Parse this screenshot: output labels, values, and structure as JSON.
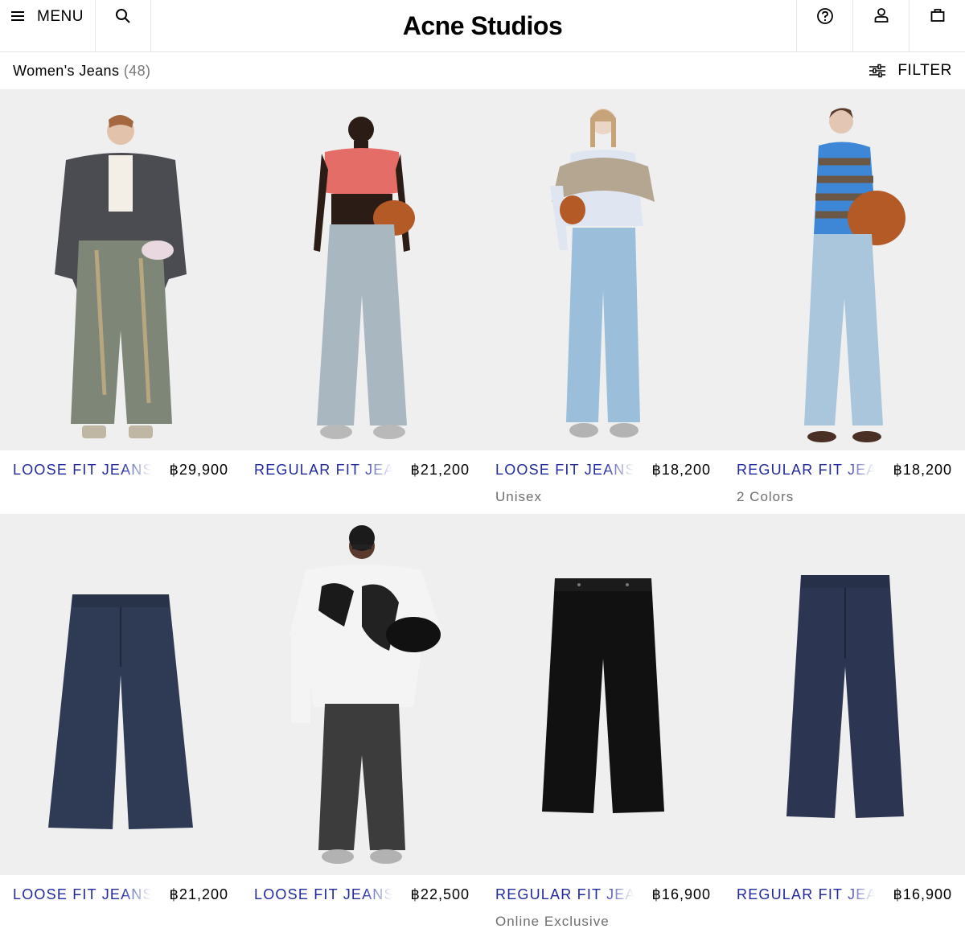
{
  "header": {
    "menu_label": "MENU",
    "logo": "Acne Studios",
    "icons": [
      "menu-icon",
      "search-icon",
      "help-icon",
      "account-icon",
      "bag-icon"
    ]
  },
  "listing": {
    "title": "Women's Jeans",
    "count": "(48)",
    "filter_label": "FILTER"
  },
  "products": [
    {
      "name": "LOOSE FIT JEANS",
      "price": "฿29,900",
      "sub": ""
    },
    {
      "name": "REGULAR FIT JEANS",
      "price": "฿21,200",
      "sub": ""
    },
    {
      "name": "LOOSE FIT JEANS",
      "price": "฿18,200",
      "sub": "Unisex"
    },
    {
      "name": "REGULAR FIT JEANS",
      "price": "฿18,200",
      "sub": "2 Colors"
    },
    {
      "name": "LOOSE FIT JEANS",
      "price": "฿21,200",
      "sub": ""
    },
    {
      "name": "LOOSE FIT JEANS",
      "price": "฿22,500",
      "sub": ""
    },
    {
      "name": "REGULAR FIT JEANS",
      "price": "฿16,900",
      "sub": "Online Exclusive"
    },
    {
      "name": "REGULAR FIT JEANS",
      "price": "฿16,900",
      "sub": ""
    }
  ],
  "colors": {
    "link": "#1f2a9e",
    "muted": "#6f6f6f",
    "border": "#e4e4e4",
    "image_bg": "#efefef"
  }
}
